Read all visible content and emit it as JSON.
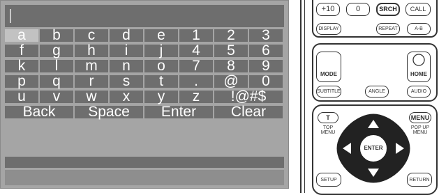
{
  "keyboard": {
    "rows": [
      [
        "a",
        "b",
        "c",
        "d",
        "e",
        "1",
        "2",
        "3"
      ],
      [
        "f",
        "g",
        "h",
        "i",
        "j",
        "4",
        "5",
        "6"
      ],
      [
        "k",
        "l",
        "m",
        "n",
        "o",
        "7",
        "8",
        "9"
      ],
      [
        "p",
        "q",
        "r",
        "s",
        "t",
        ".",
        "@",
        "0"
      ],
      [
        "u",
        "v",
        "w",
        "x",
        "y",
        "z",
        "!@#$"
      ]
    ],
    "actions": [
      "Back",
      "Space",
      "Enter",
      "Clear"
    ],
    "selected": "a"
  },
  "remote": {
    "top_row": [
      "+10",
      "0",
      "SRCH",
      "CALL"
    ],
    "row2": [
      "DISPLAY",
      "REPEAT",
      "A-B"
    ],
    "mode": "MODE",
    "home": "HOME",
    "row4": [
      "SUBTITLE",
      "ANGLE",
      "AUDIO"
    ],
    "t_btn": "T",
    "top_menu": "TOP\nMENU",
    "menu": "MENU",
    "popup_menu": "POP UP\nMENU",
    "enter": "ENTER",
    "setup": "SETUP",
    "return": "RETURN"
  }
}
